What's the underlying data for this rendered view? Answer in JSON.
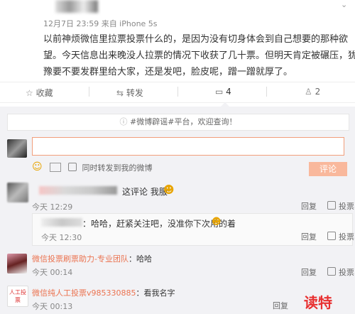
{
  "post": {
    "meta": "12月7日 23:59 来自 iPhone 5s",
    "lines": [
      "以前神烦微信里拉票投票什么的，是因为没有切身体会到自己想要的那种欲",
      "望。今天信息出来晚没人拉票的情况下收获了几十票。但明天肯定被碾压，犹",
      "豫要不要发群里给大家，还是发吧，脸皮呢，蹭一蹭就厚了。"
    ]
  },
  "actions": {
    "collect": "收藏",
    "repost": "转发",
    "comment_count": "4",
    "like_count": "2"
  },
  "topic_banner": "#微博辟谣#平台，欢迎查询！",
  "compose": {
    "input_value": "",
    "forward_label": "同时转发到我的微博",
    "submit": "评论"
  },
  "comments": [
    {
      "text": "这评论 我服",
      "time": "今天 12:29",
      "reply_label": "回复",
      "like_label": "投票"
    }
  ],
  "reply": {
    "text": "：哈哈，赶紧关注吧，没准你下次用的着",
    "time": "今天 12:30",
    "reply_label": "回复",
    "like_label": "投票"
  },
  "comment2": {
    "user": "微信投票刷票助力-专业团队",
    "text": "：哈哈",
    "time": "今天 00:14",
    "reply_label": "回复",
    "like_label": "投票"
  },
  "comment3": {
    "user": "微信纯人工投票v985330885",
    "text": "：看我名字",
    "time": "今天 00:13",
    "reply_label": "回复",
    "like_label": "投票",
    "avatar_text": "人工投票"
  },
  "watermark": "读特",
  "colors": {
    "link": "#eb7350",
    "button": "#f9b89c",
    "banner": "#f2f2f5"
  }
}
